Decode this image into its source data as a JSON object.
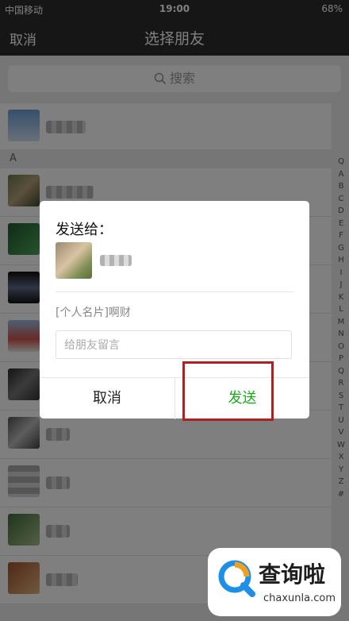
{
  "status_bar": {
    "carrier": "中国移动",
    "time": "19:00",
    "battery": "68%"
  },
  "nav": {
    "cancel": "取消",
    "title": "选择朋友"
  },
  "search": {
    "placeholder": "搜索"
  },
  "list": {
    "section_letter": "A"
  },
  "index_letters": [
    "Q",
    "A",
    "B",
    "C",
    "D",
    "E",
    "F",
    "G",
    "H",
    "I",
    "J",
    "K",
    "L",
    "M",
    "N",
    "O",
    "P",
    "Q",
    "R",
    "S",
    "T",
    "U",
    "V",
    "W",
    "X",
    "Y",
    "Z",
    "#"
  ],
  "dialog": {
    "title": "发送给：",
    "card_text": "[个人名片]啊财",
    "message_placeholder": "给朋友留言",
    "cancel": "取消",
    "send": "发送"
  },
  "watermark": {
    "text": "查询啦",
    "domain": "chaxunla.com"
  },
  "colors": {
    "nav_bg": "#2d2d2d",
    "send_green": "#1aad19",
    "highlight_red": "#b11f1f"
  }
}
